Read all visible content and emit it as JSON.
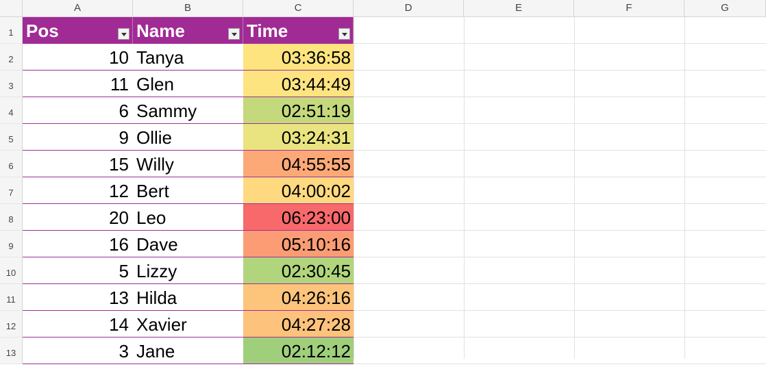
{
  "columns": [
    "A",
    "B",
    "C",
    "D",
    "E",
    "F",
    "G"
  ],
  "row_numbers": [
    "1",
    "2",
    "3",
    "4",
    "5",
    "6",
    "7",
    "8",
    "9",
    "10",
    "11",
    "12",
    "13"
  ],
  "table": {
    "headers": {
      "pos": "Pos",
      "name": "Name",
      "time": "Time"
    },
    "rows": [
      {
        "pos": "10",
        "name": "Tanya",
        "time": "03:36:58",
        "color": "#fde47f"
      },
      {
        "pos": "11",
        "name": "Glen",
        "time": "03:44:49",
        "color": "#fee381"
      },
      {
        "pos": "6",
        "name": "Sammy",
        "time": "02:51:19",
        "color": "#c4d97b"
      },
      {
        "pos": "9",
        "name": "Ollie",
        "time": "03:24:31",
        "color": "#e9e47f"
      },
      {
        "pos": "15",
        "name": "Willy",
        "time": "04:55:55",
        "color": "#fca977"
      },
      {
        "pos": "12",
        "name": "Bert",
        "time": "04:00:02",
        "color": "#fed980"
      },
      {
        "pos": "20",
        "name": "Leo",
        "time": "06:23:00",
        "color": "#f8696b"
      },
      {
        "pos": "16",
        "name": "Dave",
        "time": "05:10:16",
        "color": "#fb9c74"
      },
      {
        "pos": "5",
        "name": "Lizzy",
        "time": "02:30:45",
        "color": "#b1d57c"
      },
      {
        "pos": "13",
        "name": "Hilda",
        "time": "04:26:16",
        "color": "#fdc47c"
      },
      {
        "pos": "14",
        "name": "Xavier",
        "time": "04:27:28",
        "color": "#fdc27c"
      },
      {
        "pos": "3",
        "name": "Jane",
        "time": "02:12:12",
        "color": "#a0cf7c"
      }
    ]
  },
  "colors": {
    "header_fill": "#a12b95",
    "header_text": "#ffffff",
    "gridline": "#e1e1e1"
  }
}
